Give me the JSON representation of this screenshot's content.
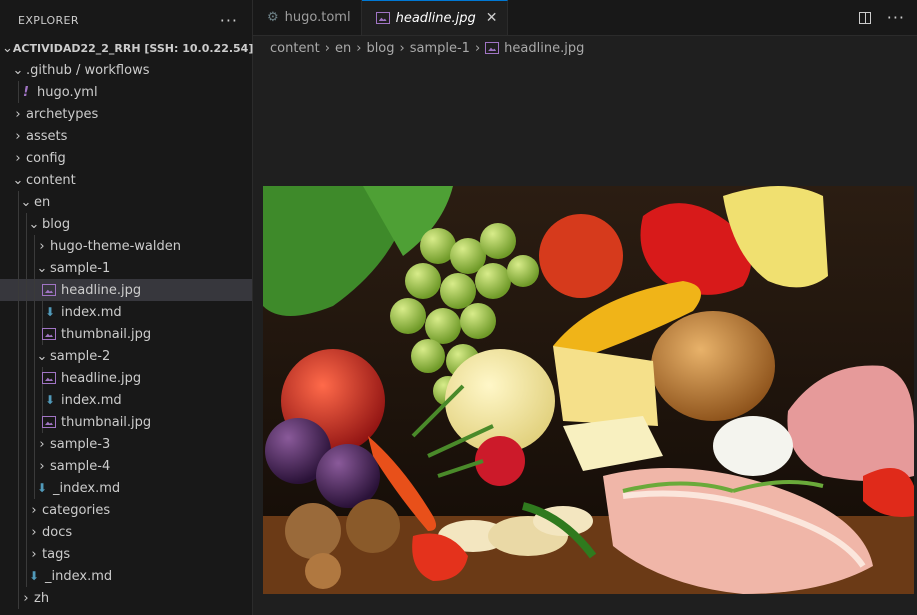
{
  "sidebar": {
    "title": "EXPLORER",
    "more": "···",
    "root": "ACTIVIDAD22_2_RRH [SSH: 10.0.22.54]",
    "items": [
      {
        "label": ".github / workflows",
        "depth": 1,
        "twisty": "⌄"
      },
      {
        "label": "hugo.yml",
        "depth": 2,
        "icon": "yml"
      },
      {
        "label": "archetypes",
        "depth": 1,
        "twisty": "›"
      },
      {
        "label": "assets",
        "depth": 1,
        "twisty": "›"
      },
      {
        "label": "config",
        "depth": 1,
        "twisty": "›"
      },
      {
        "label": "content",
        "depth": 1,
        "twisty": "⌄"
      },
      {
        "label": "en",
        "depth": 2,
        "twisty": "⌄"
      },
      {
        "label": "blog",
        "depth": 3,
        "twisty": "⌄"
      },
      {
        "label": "hugo-theme-walden",
        "depth": 4,
        "twisty": "›"
      },
      {
        "label": "sample-1",
        "depth": 4,
        "twisty": "⌄"
      },
      {
        "label": "headline.jpg",
        "depth": 5,
        "icon": "img",
        "selected": true
      },
      {
        "label": "index.md",
        "depth": 5,
        "icon": "md"
      },
      {
        "label": "thumbnail.jpg",
        "depth": 5,
        "icon": "img"
      },
      {
        "label": "sample-2",
        "depth": 4,
        "twisty": "⌄"
      },
      {
        "label": "headline.jpg",
        "depth": 5,
        "icon": "img"
      },
      {
        "label": "index.md",
        "depth": 5,
        "icon": "md"
      },
      {
        "label": "thumbnail.jpg",
        "depth": 5,
        "icon": "img"
      },
      {
        "label": "sample-3",
        "depth": 4,
        "twisty": "›"
      },
      {
        "label": "sample-4",
        "depth": 4,
        "twisty": "›"
      },
      {
        "label": "_index.md",
        "depth": 4,
        "icon": "md"
      },
      {
        "label": "categories",
        "depth": 3,
        "twisty": "›"
      },
      {
        "label": "docs",
        "depth": 3,
        "twisty": "›"
      },
      {
        "label": "tags",
        "depth": 3,
        "twisty": "›"
      },
      {
        "label": "_index.md",
        "depth": 3,
        "icon": "md"
      },
      {
        "label": "zh",
        "depth": 2,
        "twisty": "›"
      }
    ]
  },
  "tabs": [
    {
      "label": "hugo.toml",
      "icon": "gear-icon",
      "active": false
    },
    {
      "label": "headline.jpg",
      "icon": "image-icon",
      "active": true,
      "close": "✕"
    }
  ],
  "breadcrumb": [
    "content",
    "en",
    "blog",
    "sample-1",
    "headline.jpg"
  ],
  "colors": {
    "accent": "#0078d4",
    "image_icon": "#a074c4",
    "md_icon": "#519aba"
  }
}
